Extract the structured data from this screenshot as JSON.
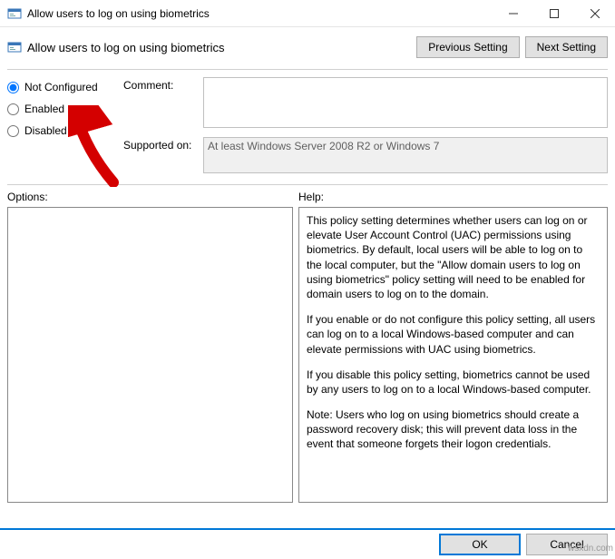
{
  "window": {
    "title": "Allow users to log on using biometrics"
  },
  "header": {
    "title": "Allow users to log on using biometrics"
  },
  "nav": {
    "prev": "Previous Setting",
    "next": "Next Setting"
  },
  "radios": {
    "not_configured": "Not Configured",
    "enabled": "Enabled",
    "disabled": "Disabled"
  },
  "labels": {
    "comment": "Comment:",
    "supported": "Supported on:",
    "options": "Options:",
    "help": "Help:"
  },
  "fields": {
    "comment_value": "",
    "supported_value": "At least Windows Server 2008 R2 or Windows 7"
  },
  "help_paragraphs": [
    "This policy setting determines whether users can log on or elevate User Account Control (UAC) permissions using biometrics.  By default, local users will be able to log on to the local computer, but the \"Allow domain users to log on using biometrics\" policy setting will need to be enabled for domain users to log on to the domain.",
    "If you enable or do not configure this policy setting, all users can log on to a local Windows-based computer and can elevate permissions with UAC using biometrics.",
    "If you disable this policy setting, biometrics cannot be used by any users to log on to a local Windows-based computer.",
    "Note: Users who log on using biometrics should create a password recovery disk; this will prevent data loss in the event that someone forgets their logon credentials."
  ],
  "footer": {
    "ok": "OK",
    "cancel": "Cancel"
  },
  "watermark": "wsxdn.com"
}
